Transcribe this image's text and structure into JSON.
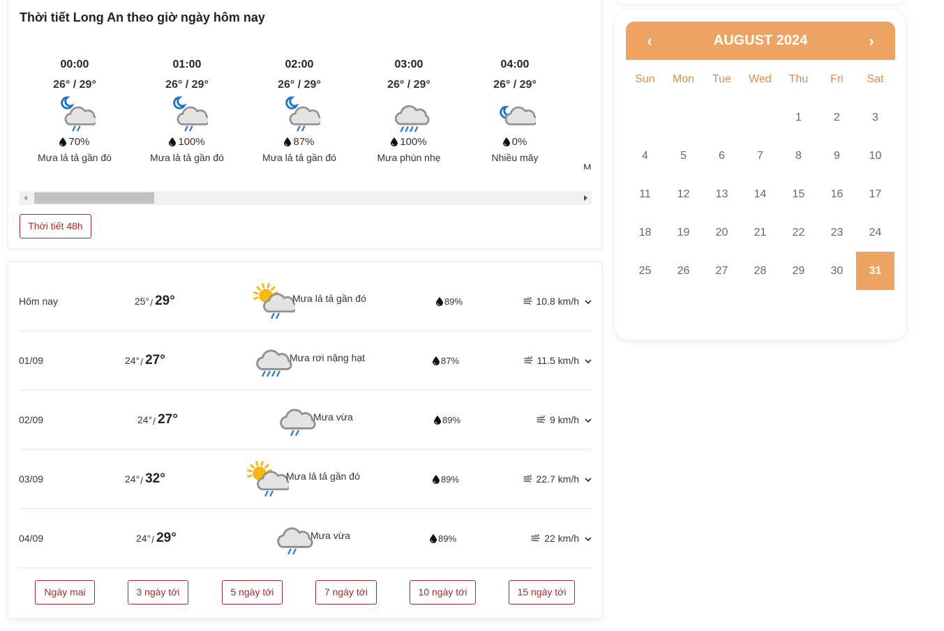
{
  "hourly": {
    "title": "Thời tiết Long An theo giờ ngày hôm nay",
    "items": [
      {
        "time": "00:00",
        "temp": "26° / 29°",
        "icon": "night-cloud-rain-icon",
        "rain": "70%",
        "desc": "Mưa lả tả gần đó"
      },
      {
        "time": "01:00",
        "temp": "26° / 29°",
        "icon": "night-cloud-rain-icon",
        "rain": "100%",
        "desc": "Mưa lả tả gần đó"
      },
      {
        "time": "02:00",
        "temp": "26° / 29°",
        "icon": "night-cloud-rain-icon",
        "rain": "87%",
        "desc": "Mưa lả tả gần đó"
      },
      {
        "time": "03:00",
        "temp": "26° / 29°",
        "icon": "cloud-drizzle-icon",
        "rain": "100%",
        "desc": "Mưa phùn nhẹ"
      },
      {
        "time": "04:00",
        "temp": "26° / 29°",
        "icon": "night-cloudy-icon",
        "rain": "0%",
        "desc": "Nhiều mây"
      },
      {
        "time": "",
        "temp": "",
        "icon": "",
        "rain": "",
        "desc": "M"
      }
    ],
    "button_48h": "Thời tiết 48h"
  },
  "daily": {
    "rows": [
      {
        "day": "Hôm nay",
        "low": "25°",
        "high": "29°",
        "icon": "sun-cloud-rain-icon",
        "desc": "Mưa lả tả gần đó",
        "rain": "89%",
        "wind": "10.8 km/h"
      },
      {
        "day": "01/09",
        "low": "24°",
        "high": "27°",
        "icon": "cloud-heavy-rain-icon",
        "desc": "Mưa rơi nặng hạt",
        "rain": "87%",
        "wind": "11.5 km/h"
      },
      {
        "day": "02/09",
        "low": "24°",
        "high": "27°",
        "icon": "cloud-rain-icon",
        "desc": "Mưa vừa",
        "rain": "89%",
        "wind": "9 km/h"
      },
      {
        "day": "03/09",
        "low": "24°",
        "high": "32°",
        "icon": "sun-cloud-rain-icon",
        "desc": "Mưa lả tả gần đó",
        "rain": "89%",
        "wind": "22.7 km/h"
      },
      {
        "day": "04/09",
        "low": "24°",
        "high": "29°",
        "icon": "cloud-rain-icon",
        "desc": "Mưa vừa",
        "rain": "89%",
        "wind": "22 km/h"
      }
    ],
    "range_buttons": [
      "Ngày mai",
      "3 ngày tới",
      "5 ngày tới",
      "7 ngày tới",
      "10 ngày tới",
      "15 ngày tới"
    ]
  },
  "calendar": {
    "title": "AUGUST 2024",
    "prev_label": "‹",
    "next_label": "›",
    "weekdays": [
      "Sun",
      "Mon",
      "Tue",
      "Wed",
      "Thu",
      "Fri",
      "Sat"
    ],
    "first_weekday_index": 4,
    "days_in_month": 31,
    "selected_day": 31,
    "accent_color": "#eda463",
    "weekday_color": "#e08a45"
  },
  "colors": {
    "button_border": "#a52a2a",
    "rain_streak": "#2b7bd3",
    "moon": "#1a73c9",
    "sun": "#f5b914"
  }
}
